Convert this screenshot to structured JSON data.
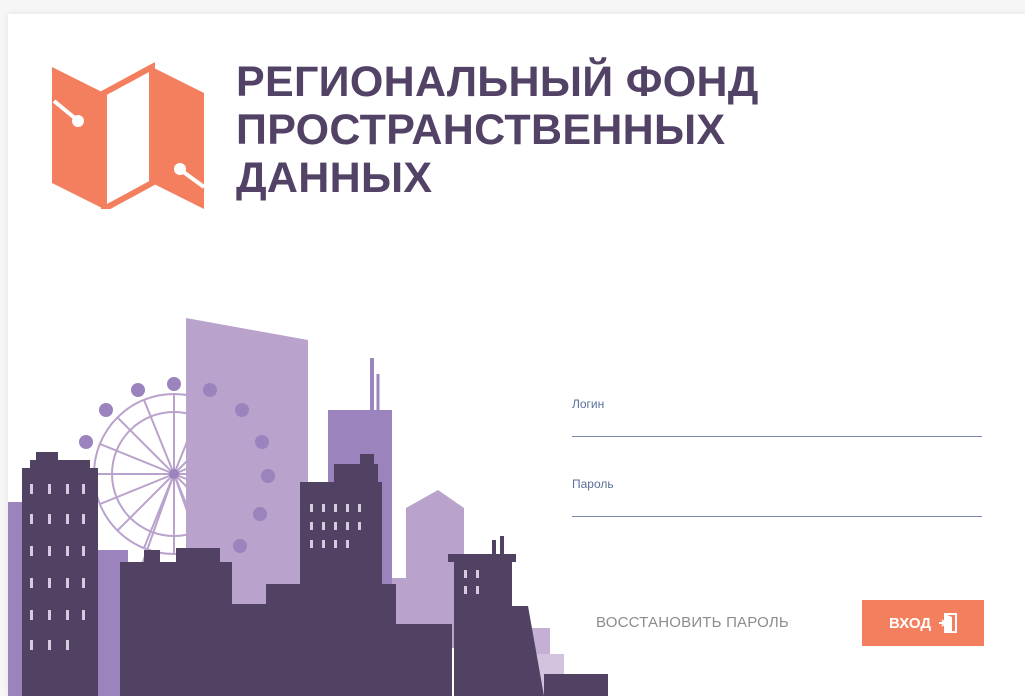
{
  "header": {
    "title_lines": [
      "РЕГИОНАЛЬНЫЙ ФОНД",
      "ПРОСТРАНСТВЕННЫХ",
      "ДАННЫХ"
    ],
    "logo_icon": "folded-map-icon"
  },
  "illustration": {
    "icon": "city-skyline-illustration"
  },
  "form": {
    "login_label": "Логин",
    "login_value": "",
    "password_label": "Пароль",
    "password_value": ""
  },
  "actions": {
    "recover_label": "ВОССТАНОВИТЬ ПАРОЛЬ",
    "login_button_label": "ВХОД",
    "login_icon": "door-enter-icon"
  },
  "colors": {
    "accent": "#f47f5f",
    "title": "#524265",
    "building_dark": "#514162",
    "building_mid": "#9b84bd",
    "building_light": "#b9a2cb",
    "field_label": "#5b6f9a"
  }
}
